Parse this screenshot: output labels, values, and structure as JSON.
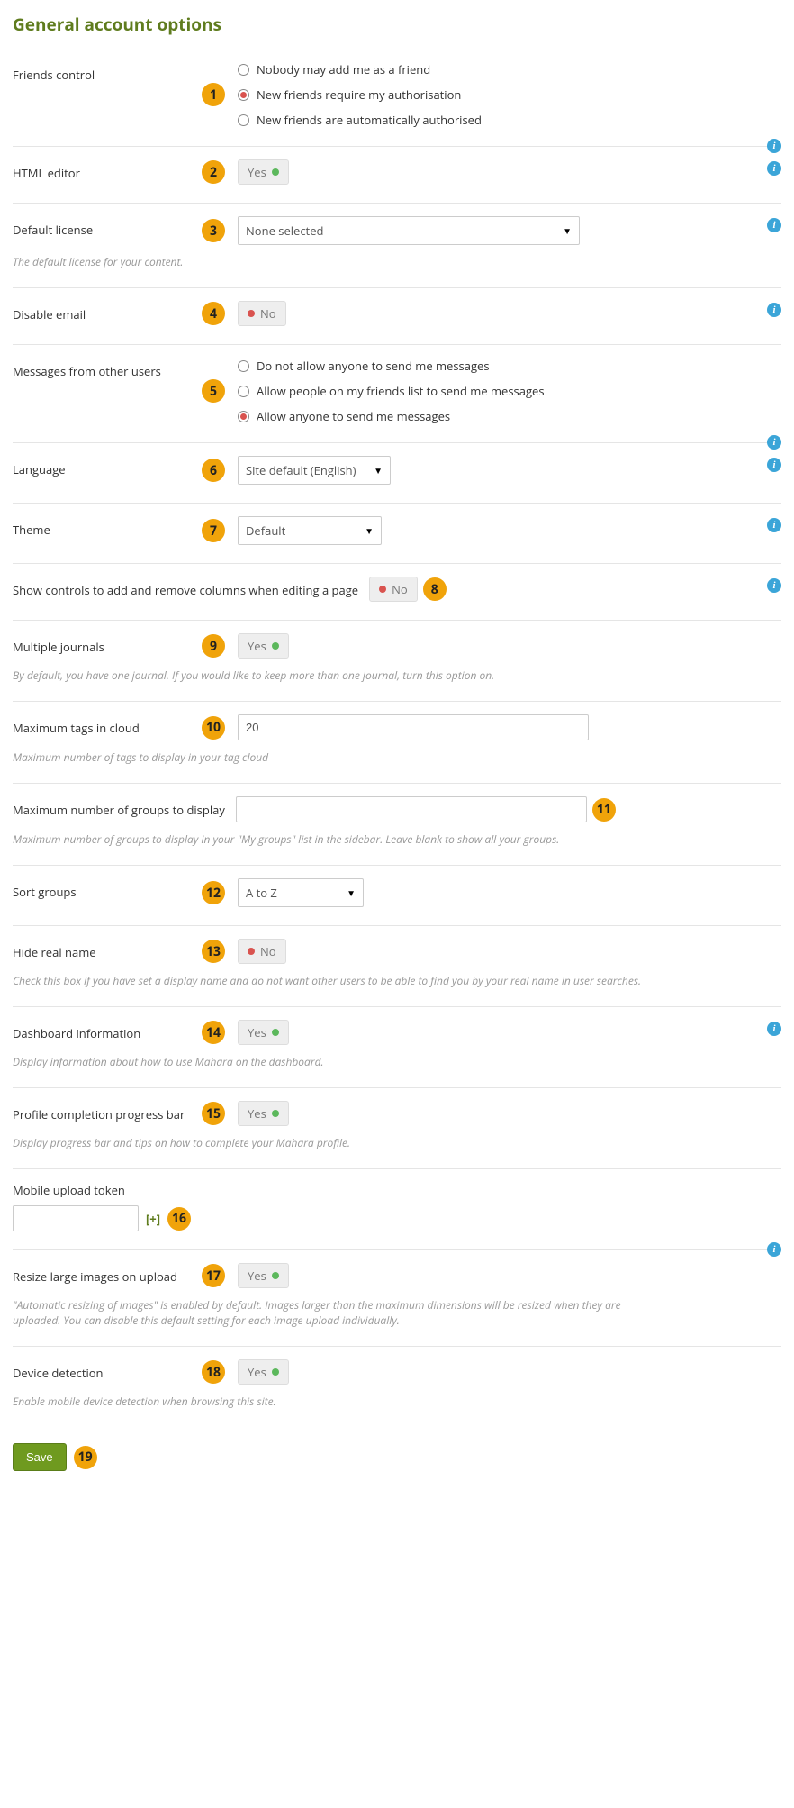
{
  "heading": "General account options",
  "friends": {
    "label": "Friends control",
    "bubble": "1",
    "options": [
      {
        "label": "Nobody may add me as a friend",
        "checked": false
      },
      {
        "label": "New friends require my authorisation",
        "checked": true
      },
      {
        "label": "New friends are automatically authorised",
        "checked": false
      }
    ]
  },
  "html_editor": {
    "label": "HTML editor",
    "bubble": "2",
    "value": "Yes",
    "on": true
  },
  "default_license": {
    "label": "Default license",
    "bubble": "3",
    "value": "None selected",
    "help": "The default license for your content."
  },
  "disable_email": {
    "label": "Disable email",
    "bubble": "4",
    "value": "No",
    "on": false
  },
  "messages": {
    "label": "Messages from other users",
    "bubble": "5",
    "options": [
      {
        "label": "Do not allow anyone to send me messages",
        "checked": false
      },
      {
        "label": "Allow people on my friends list to send me messages",
        "checked": false
      },
      {
        "label": "Allow anyone to send me messages",
        "checked": true
      }
    ]
  },
  "language": {
    "label": "Language",
    "bubble": "6",
    "value": "Site default (English)"
  },
  "theme": {
    "label": "Theme",
    "bubble": "7",
    "value": "Default"
  },
  "columns": {
    "label": "Show controls to add and remove columns when editing a page",
    "bubble": "8",
    "value": "No",
    "on": false
  },
  "journals": {
    "label": "Multiple journals",
    "bubble": "9",
    "value": "Yes",
    "on": true,
    "help": "By default, you have one journal. If you would like to keep more than one journal, turn this option on."
  },
  "max_tags": {
    "label": "Maximum tags in cloud",
    "bubble": "10",
    "value": "20",
    "help": "Maximum number of tags to display in your tag cloud"
  },
  "max_groups": {
    "label": "Maximum number of groups to display",
    "bubble": "11",
    "value": "",
    "help": "Maximum number of groups to display in your \"My groups\" list in the sidebar. Leave blank to show all your groups."
  },
  "sort_groups": {
    "label": "Sort groups",
    "bubble": "12",
    "value": "A to Z"
  },
  "hide_name": {
    "label": "Hide real name",
    "bubble": "13",
    "value": "No",
    "on": false,
    "help": "Check this box if you have set a display name and do not want other users to be able to find you by your real name in user searches."
  },
  "dashboard_info": {
    "label": "Dashboard information",
    "bubble": "14",
    "value": "Yes",
    "on": true,
    "help": "Display information about how to use Mahara on the dashboard."
  },
  "progress_bar": {
    "label": "Profile completion progress bar",
    "bubble": "15",
    "value": "Yes",
    "on": true,
    "help": "Display progress bar and tips on how to complete your Mahara profile."
  },
  "mobile_token": {
    "label": "Mobile upload token",
    "bubble": "16",
    "value": "",
    "add": "[+]"
  },
  "resize_images": {
    "label": "Resize large images on upload",
    "bubble": "17",
    "value": "Yes",
    "on": true,
    "help": "\"Automatic resizing of images\" is enabled by default. Images larger than the maximum dimensions will be resized when they are uploaded. You can disable this default setting for each image upload individually."
  },
  "device_detection": {
    "label": "Device detection",
    "bubble": "18",
    "value": "Yes",
    "on": true,
    "help": "Enable mobile device detection when browsing this site."
  },
  "save": {
    "label": "Save",
    "bubble": "19"
  }
}
